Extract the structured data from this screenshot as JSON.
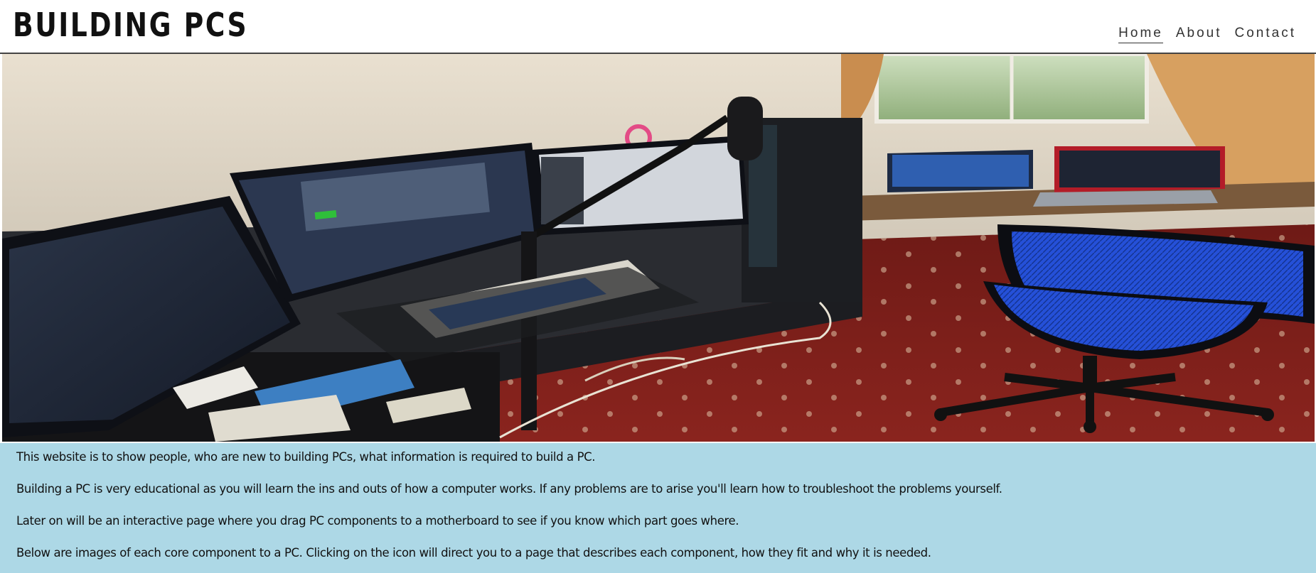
{
  "site": {
    "title": "BUILDING PCS"
  },
  "nav": {
    "items": [
      {
        "label": "Home",
        "active": true
      },
      {
        "label": "About",
        "active": false
      },
      {
        "label": "Contact",
        "active": false
      }
    ]
  },
  "hero": {
    "alt": "Desk setup with multiple monitors, keyboard, laptops and a blue office chair"
  },
  "content": {
    "paragraphs": [
      "This website is to show people, who are new to building PCs, what information is required to build a PC.",
      "Building a PC is very educational as you will learn the ins and outs of how a computer works. If any problems are to arise you'll learn how to troubleshoot the problems yourself.",
      "Later on will be an interactive page where you drag PC components to a motherboard to see if you know which part goes where.",
      "Below are images of each core component to a PC. Clicking on the icon will direct you to a page that describes each component, how they fit and why it is needed."
    ]
  },
  "colors": {
    "content_bg": "#add8e6",
    "chair": "#1f4fd6",
    "carpet": "#7a1c18"
  }
}
